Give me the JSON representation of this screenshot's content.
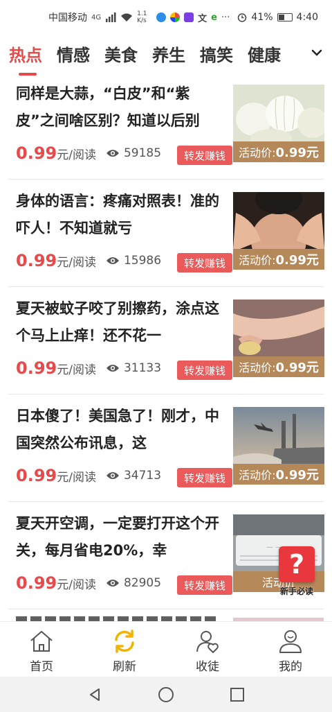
{
  "status_bar": {
    "carrier": "中国移动",
    "network": "4G",
    "speed": "1.1 K/s",
    "more": "···",
    "battery": "41%",
    "time": "4:40"
  },
  "tabs": [
    {
      "label": "热点",
      "active": true
    },
    {
      "label": "情感",
      "active": false
    },
    {
      "label": "美食",
      "active": false
    },
    {
      "label": "养生",
      "active": false
    },
    {
      "label": "搞笑",
      "active": false
    },
    {
      "label": "健康",
      "active": false
    }
  ],
  "articles": [
    {
      "title": "同样是大蒜，“白皮”和“紫皮”之间啥区别？知道以后别",
      "price": "0.99",
      "price_unit": "元/阅读",
      "views": "59185",
      "share_label": "转发赚钱",
      "promo_label": "活动价:",
      "promo_price": "0.99元",
      "thumb_icon": "garlic-image"
    },
    {
      "title": "身体的语言：疼痛对照表！准的吓人！不知道就亏",
      "price": "0.99",
      "price_unit": "元/阅读",
      "views": "15986",
      "share_label": "转发赚钱",
      "promo_label": "活动价:",
      "promo_price": "0.99元",
      "thumb_icon": "neck-massage-image"
    },
    {
      "title": "夏天被蚊子咬了别擦药，涂点这个马上止痒！还不花一",
      "price": "0.99",
      "price_unit": "元/阅读",
      "views": "31133",
      "share_label": "转发赚钱",
      "promo_label": "活动价:",
      "promo_price": "0.99元",
      "thumb_icon": "arm-soap-image"
    },
    {
      "title": "日本傻了！美国急了！刚才，中国突然公布讯息，这",
      "price": "0.99",
      "price_unit": "元/阅读",
      "views": "34713",
      "share_label": "转发赚钱",
      "promo_label": "活动价:",
      "promo_price": "0.99元",
      "thumb_icon": "warship-plane-image"
    },
    {
      "title": "夏天开空调，一定要打开这个开关，每月省电20%，幸",
      "price": "0.99",
      "price_unit": "元/阅读",
      "views": "82905",
      "share_label": "转发赚钱",
      "promo_label": "活动价",
      "promo_price": "",
      "thumb_icon": "air-conditioner-image"
    }
  ],
  "help_button": {
    "symbol": "?",
    "label": "新手必读"
  },
  "bottom_nav": [
    {
      "label": "首页",
      "icon": "home-icon"
    },
    {
      "label": "刷新",
      "icon": "refresh-icon"
    },
    {
      "label": "收徒",
      "icon": "recruit-icon"
    },
    {
      "label": "我的",
      "icon": "profile-icon"
    }
  ],
  "colors": {
    "accent": "#e64a4a",
    "promo": "#b5885a",
    "refresh": "#f0b400"
  }
}
